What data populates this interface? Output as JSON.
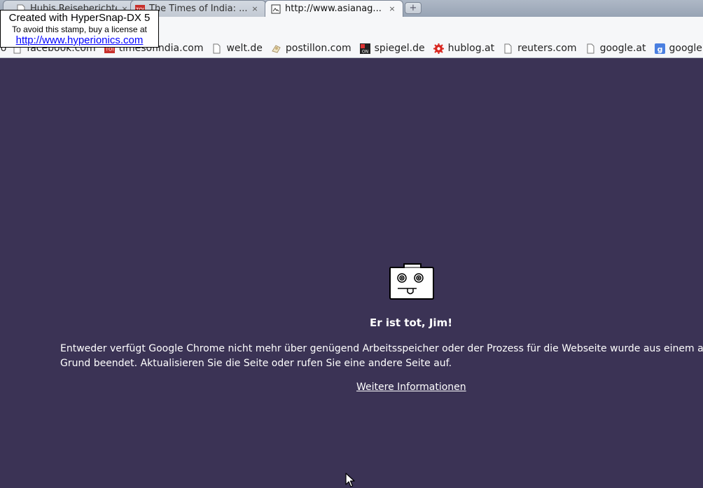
{
  "tabs": [
    {
      "title": "Hubis Reiseberichte",
      "close": "×",
      "favicon": "page-icon",
      "active": false
    },
    {
      "title": "The Times of India: ...",
      "close": "×",
      "favicon": "toi-icon",
      "active": false
    },
    {
      "title": "http://www.asianag...",
      "close": "×",
      "favicon": "broken-image-icon",
      "active": true
    }
  ],
  "new_tab_label": "+",
  "bookmarks": [
    {
      "label": "facebook.com",
      "icon": "facebook-icon"
    },
    {
      "label": "timesofindia.com",
      "icon": "toi-icon"
    },
    {
      "label": "welt.de",
      "icon": "page-icon"
    },
    {
      "label": "postillon.com",
      "icon": "postillon-icon"
    },
    {
      "label": "spiegel.de",
      "icon": "spon-icon"
    },
    {
      "label": "hublog.at",
      "icon": "gear-icon"
    },
    {
      "label": "reuters.com",
      "icon": "page-icon"
    },
    {
      "label": "google.at",
      "icon": "page-icon"
    },
    {
      "label": "google.de",
      "icon": "google-icon"
    }
  ],
  "crash": {
    "title": "Er ist tot, Jim!",
    "message": "Entweder verfügt Google Chrome nicht mehr über genügend Arbeitsspeicher oder der Prozess für die Webseite wurde aus einem anderen Grund beendet. Aktualisieren Sie die Seite oder rufen Sie eine andere Seite auf.",
    "learn_more": "Weitere Informationen"
  },
  "watermark": {
    "line1": "Created with HyperSnap-DX 5",
    "line2": "To avoid this stamp, buy a license at",
    "line3": "http://www.hyperionics.com"
  },
  "colors": {
    "background": "#3b3355",
    "text": "#ffffff"
  }
}
